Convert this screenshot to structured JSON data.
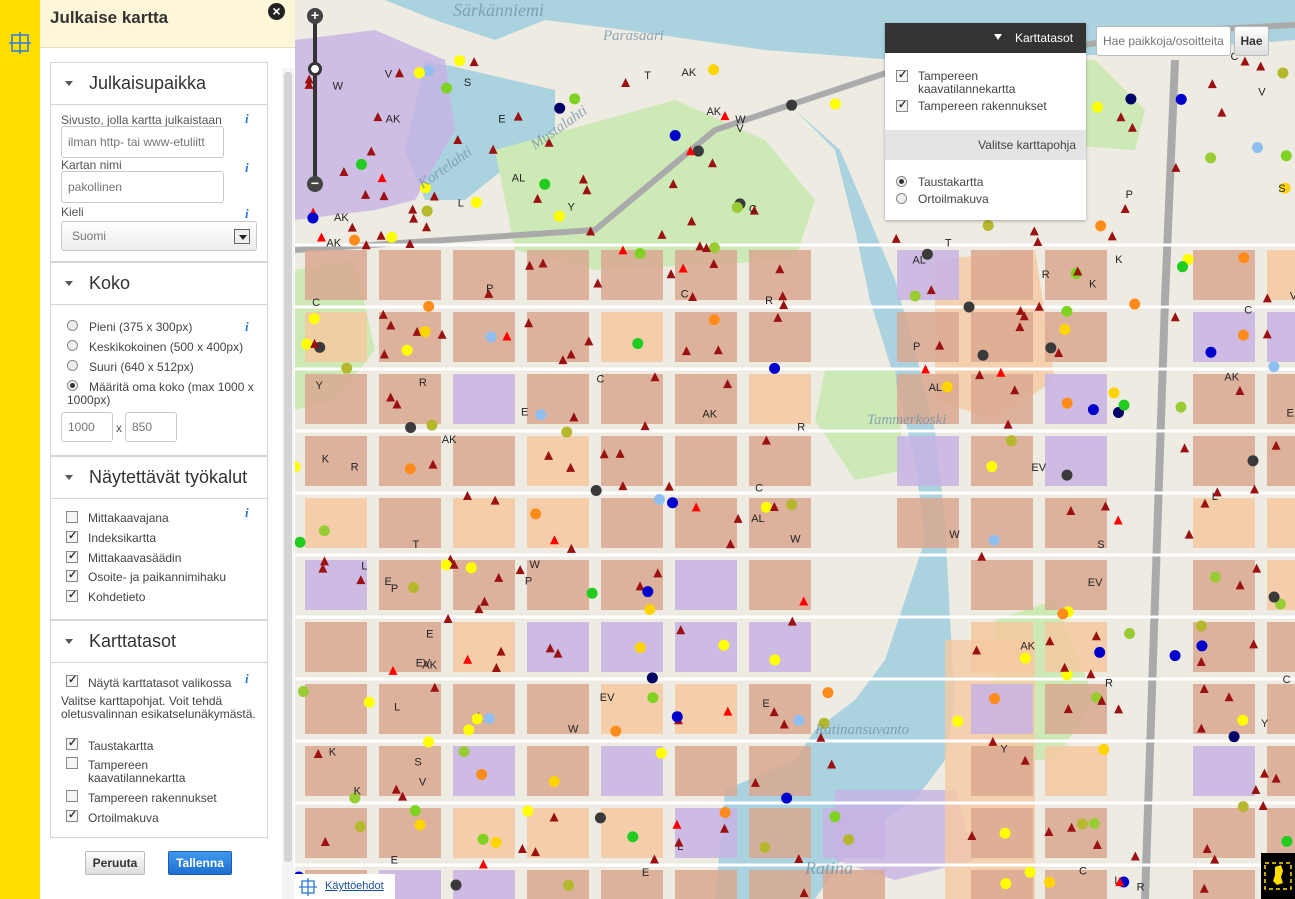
{
  "panel": {
    "title": "Julkaise kartta",
    "sections": {
      "location": {
        "title": "Julkaisupaikka",
        "site_label": "Sivusto, jolla kartta julkaistaan",
        "site_placeholder": "ilman http- tai www-etuliitt",
        "map_name_label": "Kartan nimi",
        "map_name_placeholder": "pakollinen",
        "language_label": "Kieli",
        "language_value": "Suomi"
      },
      "size": {
        "title": "Koko",
        "options": [
          "Pieni (375 x 300px)",
          "Keskikokoinen (500 x 400px)",
          "Suuri (640 x 512px)",
          "Määritä oma koko (max 1000 x 1000px)"
        ],
        "selected_index": 3,
        "width": "1000",
        "sep": "x",
        "height": "850"
      },
      "tools": {
        "title": "Näytettävät työkalut",
        "items": [
          {
            "label": "Mittakaavajana",
            "checked": false
          },
          {
            "label": "Indeksikartta",
            "checked": true
          },
          {
            "label": "Mittakaavasäädin",
            "checked": true
          },
          {
            "label": "Osoite- ja paikannimihaku",
            "checked": true
          },
          {
            "label": "Kohdetieto",
            "checked": true
          }
        ]
      },
      "layers": {
        "title": "Karttatasot",
        "show_in_menu_label": "Näytä karttatasot valikossa",
        "show_in_menu_checked": true,
        "help": "Valitse karttapohjat. Voit tehdä oletusvalinnan esikatselunäkymästä.",
        "items": [
          {
            "label": "Taustakartta",
            "checked": true
          },
          {
            "label": "Tampereen kaavatilannekartta",
            "checked": false
          },
          {
            "label": "Tampereen rakennukset",
            "checked": false
          },
          {
            "label": "Ortoilmakuva",
            "checked": true
          }
        ]
      }
    },
    "cancel_label": "Peruuta",
    "save_label": "Tallenna"
  },
  "map": {
    "layers_panel": {
      "title": "Karttatasot",
      "overlays": [
        {
          "label": "Tampereen kaavatilannekartta",
          "checked": true
        },
        {
          "label": "Tampereen rakennukset",
          "checked": true
        }
      ],
      "base_title": "Valitse karttapohja",
      "bases": [
        {
          "label": "Taustakartta",
          "selected": true
        },
        {
          "label": "Ortoilmakuva",
          "selected": false
        }
      ]
    },
    "search_placeholder": "Hae paikkoja/osoitteita",
    "search_button": "Hae",
    "terms_link": "Käyttöehdot",
    "place_names": [
      "Särkänniemi",
      "Parasaari",
      "Kortelahti",
      "Mustalahti",
      "Tammerkoski",
      "Ratinansuvanto",
      "Ratina"
    ],
    "zone_letters": [
      "AK",
      "AL",
      "K",
      "Y",
      "V",
      "L",
      "T",
      "W",
      "E",
      "C",
      "R",
      "S",
      "EV",
      "P"
    ],
    "colors": {
      "water": "#aad3df",
      "park": "#cde9b5",
      "block_ak": "#d9a891",
      "block_k": "#f5c9a0",
      "block_y": "#c7b3e4",
      "marker_red": "#9b1111"
    }
  }
}
